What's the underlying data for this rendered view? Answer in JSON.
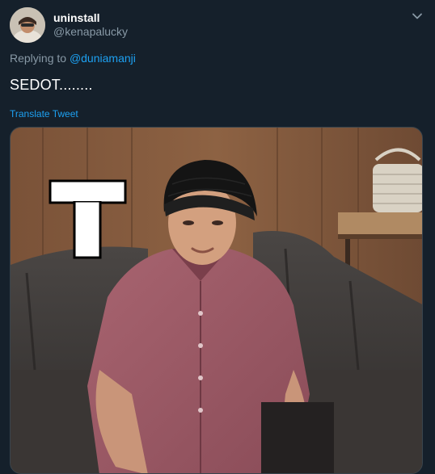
{
  "tweet": {
    "display_name": "uninstall",
    "handle": "@kenapalucky",
    "replying_prefix": "Replying to",
    "replying_mention": "@duniamanji",
    "text": "SEDOT........",
    "translate_label": "Translate Tweet",
    "media_overlay_letter": "T"
  },
  "icons": {
    "more": "chevron-down-icon"
  },
  "colors": {
    "background": "#15202b",
    "accent": "#1da1f2",
    "secondary_text": "#8899a6",
    "border": "#38444d"
  }
}
